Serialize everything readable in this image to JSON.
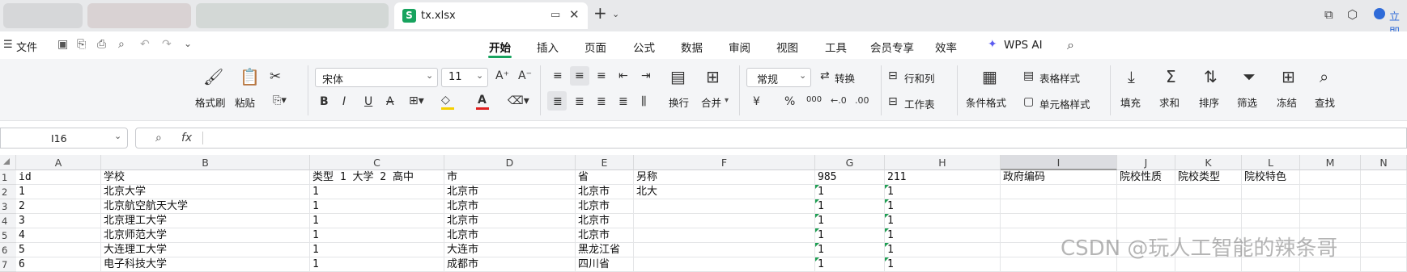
{
  "tabs": {
    "active": "tx.xlsx"
  },
  "quick": {
    "file": "文件"
  },
  "menu": [
    "开始",
    "插入",
    "页面",
    "公式",
    "数据",
    "审阅",
    "视图",
    "工具",
    "会员专享",
    "效率",
    "WPS AI"
  ],
  "header_right": {
    "login": "立即"
  },
  "ribbon": {
    "format_painter": "格式刷",
    "paste": "粘贴",
    "font_name": "宋体",
    "font_size": "11",
    "wrap": "换行",
    "merge": "合并",
    "number_format": "常规",
    "convert": "转换",
    "rows_cols": "行和列",
    "worksheet": "工作表",
    "conditional": "条件格式",
    "table_style": "表格样式",
    "cell_style": "单元格样式",
    "fill": "填充",
    "sum": "求和",
    "sort": "排序",
    "filter": "筛选",
    "freeze": "冻结",
    "find": "查找",
    "currency_symbol": "¥",
    "percent_symbol": "%",
    "thousands_symbol": "000"
  },
  "formula_bar": {
    "name_box": "I16",
    "fx": "fx"
  },
  "columns": [
    "A",
    "B",
    "C",
    "D",
    "E",
    "F",
    "G",
    "H",
    "I",
    "J",
    "K",
    "L",
    "M",
    "N"
  ],
  "row_numbers": [
    "1",
    "2",
    "3",
    "4",
    "5",
    "6",
    "7"
  ],
  "rows": [
    [
      "id",
      "学校",
      "类型 1 大学 2 高中",
      "市",
      "省",
      "另称",
      "985",
      "211",
      "政府编码",
      "院校性质",
      "院校类型",
      "院校特色",
      "",
      ""
    ],
    [
      "1",
      "北京大学",
      "1",
      "北京市",
      "北京市",
      "北大",
      "1",
      "1",
      "",
      "",
      "",
      "",
      "",
      ""
    ],
    [
      "2",
      "北京航空航天大学",
      "1",
      "北京市",
      "北京市",
      "",
      "1",
      "1",
      "",
      "",
      "",
      "",
      "",
      ""
    ],
    [
      "3",
      "北京理工大学",
      "1",
      "北京市",
      "北京市",
      "",
      "1",
      "1",
      "",
      "",
      "",
      "",
      "",
      ""
    ],
    [
      "4",
      "北京师范大学",
      "1",
      "北京市",
      "北京市",
      "",
      "1",
      "1",
      "",
      "",
      "",
      "",
      "",
      ""
    ],
    [
      "5",
      "大连理工大学",
      "1",
      "大连市",
      "黑龙江省",
      "",
      "1",
      "1",
      "",
      "",
      "",
      "",
      "",
      ""
    ],
    [
      "6",
      "电子科技大学",
      "1",
      "成都市",
      "四川省",
      "",
      "1",
      "1",
      "",
      "",
      "",
      "",
      "",
      ""
    ]
  ],
  "watermark": "CSDN @玩人工智能的辣条哥",
  "colors": {
    "accent_green": "#17a35e",
    "ribbon_bg": "#f4f5f7"
  }
}
